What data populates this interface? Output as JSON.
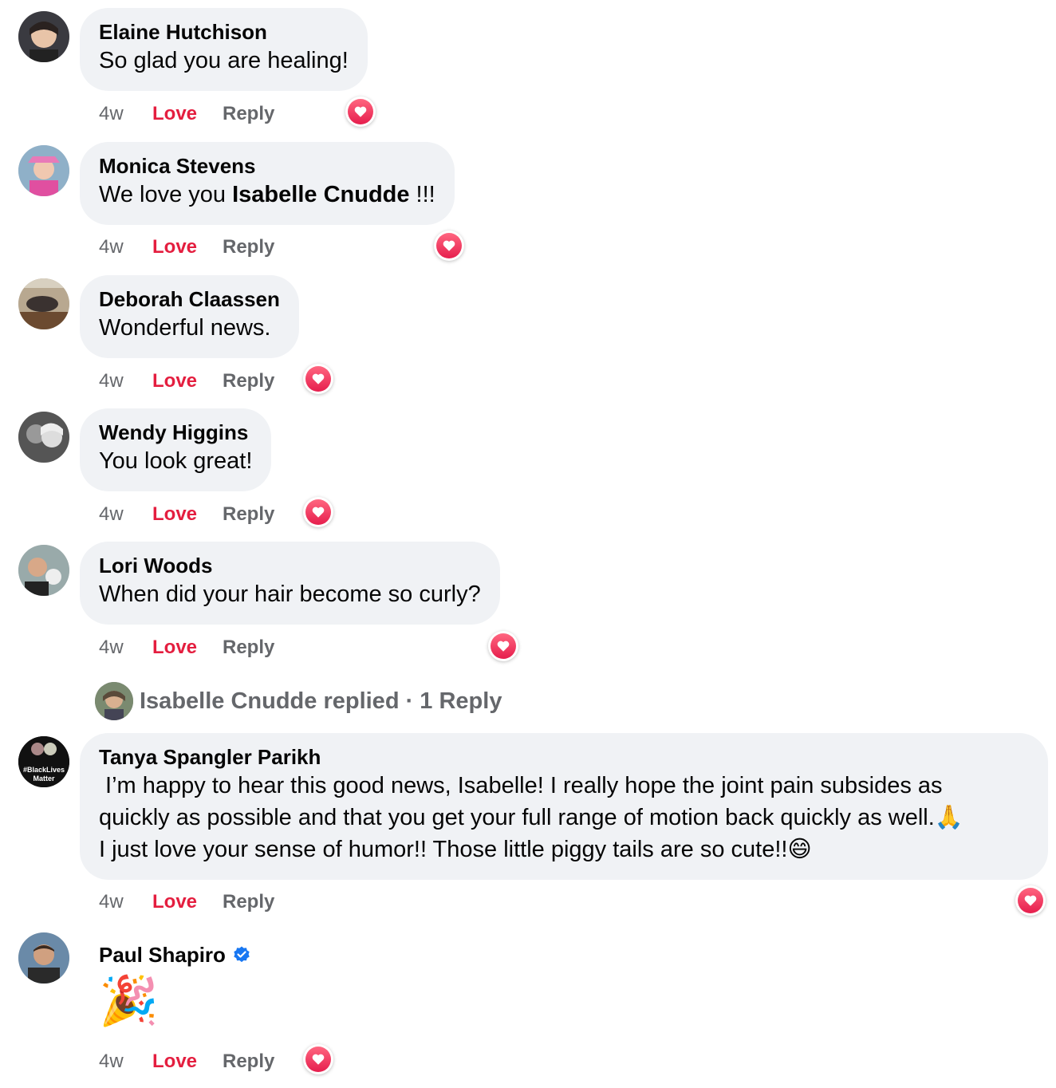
{
  "colors": {
    "love": "#e41e3f",
    "muted": "#65676b",
    "bubble": "#f0f2f5",
    "verified": "#1877f2"
  },
  "comments": [
    {
      "author": "Elaine Hutchison",
      "text": "So glad you are healing!",
      "time": "4w",
      "love": "Love",
      "reply": "Reply",
      "reaction": "love-icon"
    },
    {
      "author": "Monica Stevens",
      "text_before": "We love you ",
      "mention": "Isabelle Cnudde",
      "text_after": " !!!",
      "time": "4w",
      "love": "Love",
      "reply": "Reply",
      "reaction": "love-icon"
    },
    {
      "author": "Deborah Claassen",
      "text": "Wonderful news.",
      "time": "4w",
      "love": "Love",
      "reply": "Reply",
      "reaction": "love-icon"
    },
    {
      "author": "Wendy Higgins",
      "text": "You look great!",
      "time": "4w",
      "love": "Love",
      "reply": "Reply",
      "reaction": "love-icon"
    },
    {
      "author": "Lori Woods",
      "text": "When did your hair become so curly?",
      "time": "4w",
      "love": "Love",
      "reply": "Reply",
      "reaction": "love-icon"
    },
    {
      "author": "Tanya Spangler Parikh",
      "avatar_text": "#BlackLives Matter",
      "line1": " I’m happy to hear this good news, Isabelle! I really hope the joint pain subsides as",
      "line2": "quickly as possible and that you get your full range of motion back quickly as well.🙏",
      "line3": "I just love your sense of humor!! Those little piggy tails are so cute!!😄",
      "time": "4w",
      "love": "Love",
      "reply": "Reply",
      "reaction": "love-icon"
    },
    {
      "author": "Paul Shapiro",
      "text": "🎉",
      "time": "4w",
      "love": "Love",
      "reply": "Reply",
      "reaction": "love-icon",
      "verified": true
    }
  ],
  "replies_link": {
    "text": "Isabelle Cnudde replied · 1 Reply"
  }
}
